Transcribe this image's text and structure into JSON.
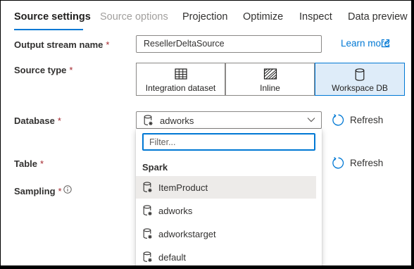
{
  "tabs": [
    {
      "label": "Source settings",
      "state": "active"
    },
    {
      "label": "Source options",
      "state": "disabled"
    },
    {
      "label": "Projection",
      "state": "normal"
    },
    {
      "label": "Optimize",
      "state": "normal"
    },
    {
      "label": "Inspect",
      "state": "normal"
    },
    {
      "label": "Data preview",
      "state": "normal"
    }
  ],
  "form": {
    "output_stream": {
      "label": "Output stream name",
      "required_mark": "*",
      "value": "ResellerDeltaSource"
    },
    "learn_more": "Learn more",
    "source_type": {
      "label": "Source type",
      "required_mark": "*",
      "options": [
        {
          "label": "Integration dataset",
          "icon": "table-icon"
        },
        {
          "label": "Inline",
          "icon": "hatch-icon"
        },
        {
          "label": "Workspace DB",
          "icon": "database-icon"
        }
      ],
      "selected": "Workspace DB"
    },
    "database": {
      "label": "Database",
      "required_mark": "*",
      "value": "adworks"
    },
    "table": {
      "label": "Table",
      "required_mark": "*"
    },
    "sampling": {
      "label": "Sampling",
      "required_mark": "*"
    },
    "refresh_label": "Refresh"
  },
  "dropdown_panel": {
    "filter_placeholder": "Filter...",
    "group": "Spark",
    "items": [
      "ItemProduct",
      "adworks",
      "adworkstarget",
      "default"
    ],
    "highlighted": "ItemProduct"
  },
  "colors": {
    "accent": "#0078d4",
    "required": "#a4262c",
    "selected_bg": "#deecf9",
    "hover_bg": "#edebe9"
  }
}
